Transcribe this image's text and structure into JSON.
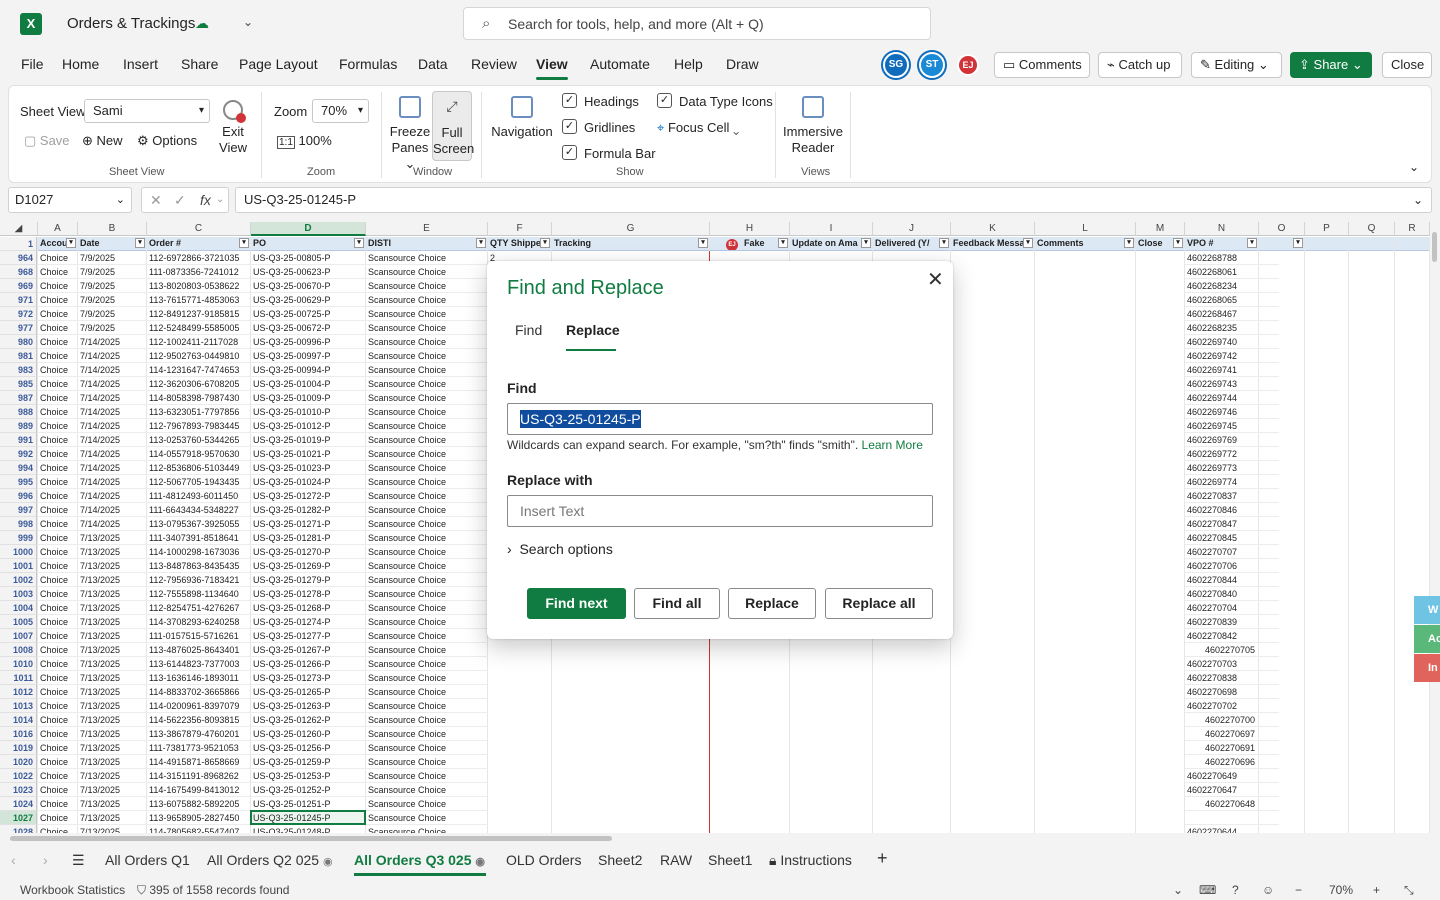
{
  "app": {
    "title": "Orders & Trackings",
    "logo_letter": "X",
    "search_placeholder": "Search for tools, help, and more (Alt + Q)"
  },
  "menu": [
    "File",
    "Home",
    "Insert",
    "Share",
    "Page Layout",
    "Formulas",
    "Data",
    "Review",
    "View",
    "Automate",
    "Help",
    "Draw"
  ],
  "header_actions": {
    "presence": [
      {
        "initials": "SG",
        "color": "#0f6cbd"
      },
      {
        "initials": "ST",
        "color": "#1b8ad6"
      },
      {
        "initials": "EJ",
        "color": "#d13438"
      }
    ],
    "comments": "Comments",
    "catch_up": "Catch up",
    "editing": "Editing",
    "share": "Share",
    "close": "Close"
  },
  "ribbon": {
    "sheet_view_label": "Sheet View",
    "sheet_view_value": "Sami",
    "save": "Save",
    "new": "New",
    "options": "Options",
    "exit_view": [
      "Exit",
      "View"
    ],
    "group_sheet_view": "Sheet View",
    "zoom_label": "Zoom",
    "zoom_value": "70%",
    "zoom_100": "100%",
    "group_zoom": "Zoom",
    "freeze_panes": [
      "Freeze",
      "Panes"
    ],
    "full_screen": [
      "Full",
      "Screen"
    ],
    "group_window": "Window",
    "navigation": "Navigation",
    "headings": "Headings",
    "gridlines": "Gridlines",
    "formula_bar": "Formula Bar",
    "data_type_icons": "Data Type Icons",
    "focus_cell": "Focus Cell",
    "group_show": "Show",
    "immersive_reader": [
      "Immersive",
      "Reader"
    ],
    "group_views": "Views"
  },
  "formula_bar": {
    "name_box": "D1027",
    "formula": "US-Q3-25-01245-P"
  },
  "sheet": {
    "columns": [
      "A",
      "B",
      "C",
      "D",
      "E",
      "F",
      "G",
      "H",
      "I",
      "J",
      "K",
      "L",
      "M",
      "N",
      "O",
      "P",
      "Q",
      "R"
    ],
    "header_row_num": "1",
    "headers": [
      "Accou",
      "Date",
      "Order #",
      "PO",
      "DISTI",
      "QTY Shippe",
      "Tracking",
      "Fake",
      "Update on Ama",
      "Delivered (Y/",
      "Feedback Messa",
      "Comments",
      "Close",
      "VPO #",
      "",
      "",
      "",
      ""
    ],
    "fake_badge": "EJ",
    "qty_first": "2",
    "rows": [
      [
        "964",
        "Choice",
        "7/9/2025",
        "112-6972866-3721035",
        "US-Q3-25-00805-P",
        "Scansource Choice",
        "4602268788"
      ],
      [
        "968",
        "Choice",
        "7/9/2025",
        "111-0873356-7241012",
        "US-Q3-25-00623-P",
        "Scansource Choice",
        "4602268061"
      ],
      [
        "969",
        "Choice",
        "7/9/2025",
        "113-8020803-0538622",
        "US-Q3-25-00670-P",
        "Scansource Choice",
        "4602268234"
      ],
      [
        "971",
        "Choice",
        "7/9/2025",
        "113-7615771-4853063",
        "US-Q3-25-00629-P",
        "Scansource Choice",
        "4602268065"
      ],
      [
        "972",
        "Choice",
        "7/9/2025",
        "112-8491237-9185815",
        "US-Q3-25-00725-P",
        "Scansource Choice",
        "4602268467"
      ],
      [
        "977",
        "Choice",
        "7/9/2025",
        "112-5248499-5585005",
        "US-Q3-25-00672-P",
        "Scansource Choice",
        "4602268235"
      ],
      [
        "980",
        "Choice",
        "7/14/2025",
        "112-1002411-2117028",
        "US-Q3-25-00996-P",
        "Scansource Choice",
        "4602269740"
      ],
      [
        "981",
        "Choice",
        "7/14/2025",
        "112-9502763-0449810",
        "US-Q3-25-00997-P",
        "Scansource Choice",
        "4602269742"
      ],
      [
        "983",
        "Choice",
        "7/14/2025",
        "114-1231647-7474653",
        "US-Q3-25-00994-P",
        "Scansource Choice",
        "4602269741"
      ],
      [
        "985",
        "Choice",
        "7/14/2025",
        "112-3620306-6708205",
        "US-Q3-25-01004-P",
        "Scansource Choice",
        "4602269743"
      ],
      [
        "987",
        "Choice",
        "7/14/2025",
        "114-8058398-7987430",
        "US-Q3-25-01009-P",
        "Scansource Choice",
        "4602269744"
      ],
      [
        "988",
        "Choice",
        "7/14/2025",
        "113-6323051-7797856",
        "US-Q3-25-01010-P",
        "Scansource Choice",
        "4602269746"
      ],
      [
        "989",
        "Choice",
        "7/14/2025",
        "112-7967893-7983445",
        "US-Q3-25-01012-P",
        "Scansource Choice",
        "4602269745"
      ],
      [
        "991",
        "Choice",
        "7/14/2025",
        "113-0253760-5344265",
        "US-Q3-25-01019-P",
        "Scansource Choice",
        "4602269769"
      ],
      [
        "992",
        "Choice",
        "7/14/2025",
        "114-0557918-9570630",
        "US-Q3-25-01021-P",
        "Scansource Choice",
        "4602269772"
      ],
      [
        "994",
        "Choice",
        "7/14/2025",
        "112-8536806-5103449",
        "US-Q3-25-01023-P",
        "Scansource Choice",
        "4602269773"
      ],
      [
        "995",
        "Choice",
        "7/14/2025",
        "112-5067705-1943435",
        "US-Q3-25-01024-P",
        "Scansource Choice",
        "4602269774"
      ],
      [
        "996",
        "Choice",
        "7/14/2025",
        "111-4812493-6011450",
        "US-Q3-25-01272-P",
        "Scansource Choice",
        "4602270837"
      ],
      [
        "997",
        "Choice",
        "7/14/2025",
        "111-6643434-5348227",
        "US-Q3-25-01282-P",
        "Scansource Choice",
        "4602270846"
      ],
      [
        "998",
        "Choice",
        "7/14/2025",
        "113-0795367-3925055",
        "US-Q3-25-01271-P",
        "Scansource Choice",
        "4602270847"
      ],
      [
        "999",
        "Choice",
        "7/13/2025",
        "111-3407391-8518641",
        "US-Q3-25-01281-P",
        "Scansource Choice",
        "4602270845"
      ],
      [
        "1000",
        "Choice",
        "7/13/2025",
        "114-1000298-1673036",
        "US-Q3-25-01270-P",
        "Scansource Choice",
        "4602270707"
      ],
      [
        "1001",
        "Choice",
        "7/13/2025",
        "113-8487863-8435435",
        "US-Q3-25-01269-P",
        "Scansource Choice",
        "4602270706"
      ],
      [
        "1002",
        "Choice",
        "7/13/2025",
        "112-7956936-7183421",
        "US-Q3-25-01279-P",
        "Scansource Choice",
        "4602270844"
      ],
      [
        "1003",
        "Choice",
        "7/13/2025",
        "112-7555898-1134640",
        "US-Q3-25-01278-P",
        "Scansource Choice",
        "4602270840"
      ],
      [
        "1004",
        "Choice",
        "7/13/2025",
        "112-8254751-4276267",
        "US-Q3-25-01268-P",
        "Scansource Choice",
        "4602270704"
      ],
      [
        "1005",
        "Choice",
        "7/13/2025",
        "114-3708293-6240258",
        "US-Q3-25-01274-P",
        "Scansource Choice",
        "4602270839"
      ],
      [
        "1007",
        "Choice",
        "7/13/2025",
        "111-0157515-5716261",
        "US-Q3-25-01277-P",
        "Scansource Choice",
        "4602270842"
      ],
      [
        "1008",
        "Choice",
        "7/13/2025",
        "113-4876025-8643401",
        "US-Q3-25-01267-P",
        "Scansource Choice",
        "4602270705"
      ],
      [
        "1010",
        "Choice",
        "7/13/2025",
        "113-6144823-7377003",
        "US-Q3-25-01266-P",
        "Scansource Choice",
        "4602270703"
      ],
      [
        "1011",
        "Choice",
        "7/13/2025",
        "113-1636146-1893011",
        "US-Q3-25-01273-P",
        "Scansource Choice",
        "4602270838"
      ],
      [
        "1012",
        "Choice",
        "7/13/2025",
        "114-8833702-3665866",
        "US-Q3-25-01265-P",
        "Scansource Choice",
        "4602270698"
      ],
      [
        "1013",
        "Choice",
        "7/13/2025",
        "114-0200961-8397079",
        "US-Q3-25-01263-P",
        "Scansource Choice",
        "4602270702"
      ],
      [
        "1014",
        "Choice",
        "7/13/2025",
        "114-5622356-8093815",
        "US-Q3-25-01262-P",
        "Scansource Choice",
        "4602270700"
      ],
      [
        "1016",
        "Choice",
        "7/13/2025",
        "113-3867879-4760201",
        "US-Q3-25-01260-P",
        "Scansource Choice",
        "4602270697"
      ],
      [
        "1019",
        "Choice",
        "7/13/2025",
        "111-7381773-9521053",
        "US-Q3-25-01256-P",
        "Scansource Choice",
        "4602270691"
      ],
      [
        "1020",
        "Choice",
        "7/13/2025",
        "114-4915871-8658669",
        "US-Q3-25-01259-P",
        "Scansource Choice",
        "4602270696"
      ],
      [
        "1022",
        "Choice",
        "7/13/2025",
        "114-3151191-8968262",
        "US-Q3-25-01253-P",
        "Scansource Choice",
        "4602270649"
      ],
      [
        "1023",
        "Choice",
        "7/13/2025",
        "114-1675499-8413012",
        "US-Q3-25-01252-P",
        "Scansource Choice",
        "4602270647"
      ],
      [
        "1024",
        "Choice",
        "7/13/2025",
        "113-6075882-5892205",
        "US-Q3-25-01251-P",
        "Scansource Choice",
        "4602270648"
      ],
      [
        "1027",
        "Choice",
        "7/13/2025",
        "113-9658905-2827450",
        "US-Q3-25-01245-P",
        "Scansource Choice",
        ""
      ],
      [
        "1028",
        "Choice",
        "7/13/2025",
        "114-7805682-5547407",
        "US-Q3-25-01248-P",
        "Scansource Choice",
        "4602270644"
      ]
    ],
    "right_aligned_vpo_rows": [
      "1008",
      "1014",
      "1016",
      "1019",
      "1020",
      "1024"
    ]
  },
  "side_tabs": [
    {
      "label": "W",
      "color": "#6fc3e3"
    },
    {
      "label": "Ac",
      "color": "#5ab87a"
    },
    {
      "label": "In",
      "color": "#e0645c"
    }
  ],
  "sheet_tabs": [
    "All Orders Q1",
    "All Orders Q2 025",
    "All Orders Q3 025",
    "OLD Orders",
    "Sheet2",
    "RAW",
    "Sheet1",
    "Instructions"
  ],
  "active_sheet_tab": "All Orders Q3 025",
  "status": {
    "workbook_stats": "Workbook Statistics",
    "filter_result": "395 of 1558 records found",
    "zoom": "70%"
  },
  "dialog": {
    "title": "Find and Replace",
    "tab_find": "Find",
    "tab_replace": "Replace",
    "find_label": "Find",
    "find_value": "US-Q3-25-01245-P",
    "help_text": "Wildcards can expand search. For example, \"sm?th\" finds \"smith\".",
    "learn_more": "Learn More",
    "replace_label": "Replace with",
    "replace_placeholder": "Insert Text",
    "search_options": "Search options",
    "btn_find_next": "Find next",
    "btn_find_all": "Find all",
    "btn_replace": "Replace",
    "btn_replace_all": "Replace all"
  }
}
